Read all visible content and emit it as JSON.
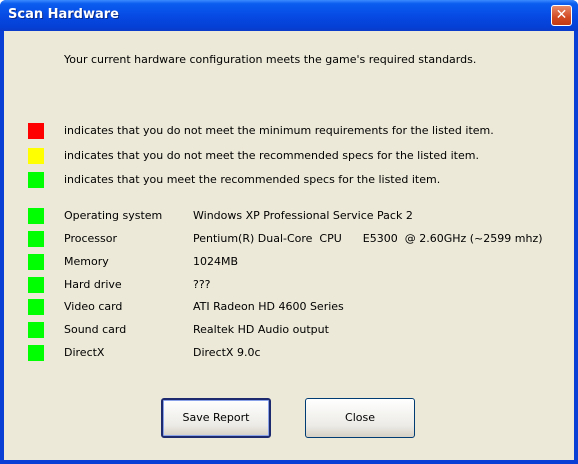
{
  "window": {
    "title": "Scan Hardware",
    "close_glyph": "✕"
  },
  "message": "Your current hardware configuration meets the game's required standards.",
  "legend": [
    {
      "color": "#ff0000",
      "text": "indicates that you do not meet the minimum requirements for the listed item."
    },
    {
      "color": "#ffff00",
      "text": "indicates that you do not meet the recommended specs for the listed item."
    },
    {
      "color": "#00ff00",
      "text": "indicates that you meet the recommended specs for the listed item."
    }
  ],
  "items": [
    {
      "status": "#00ff00",
      "label": "Operating system",
      "value": "Windows XP Professional Service Pack 2"
    },
    {
      "status": "#00ff00",
      "label": "Processor",
      "value": "Pentium(R) Dual-Core  CPU      E5300  @ 2.60GHz (~2599 mhz)"
    },
    {
      "status": "#00ff00",
      "label": "Memory",
      "value": "1024MB"
    },
    {
      "status": "#00ff00",
      "label": "Hard drive",
      "value": "???"
    },
    {
      "status": "#00ff00",
      "label": "Video card",
      "value": "ATI Radeon HD 4600 Series"
    },
    {
      "status": "#00ff00",
      "label": "Sound card",
      "value": "Realtek HD Audio output"
    },
    {
      "status": "#00ff00",
      "label": "DirectX",
      "value": "DirectX 9.0c"
    }
  ],
  "buttons": {
    "save": "Save Report",
    "close": "Close"
  }
}
